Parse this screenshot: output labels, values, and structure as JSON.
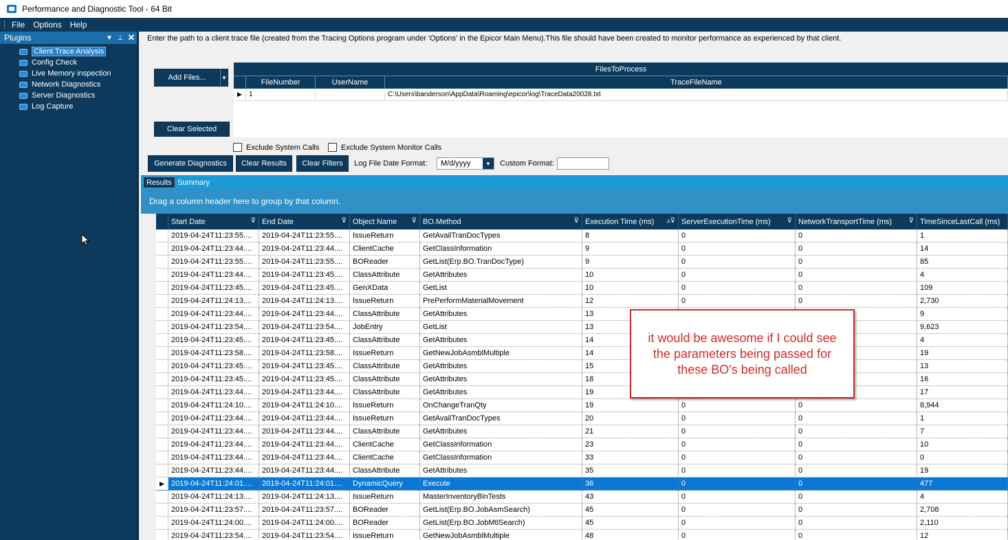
{
  "window": {
    "title": "Performance and Diagnostic Tool - 64 Bit"
  },
  "menu": [
    "File",
    "Options",
    "Help"
  ],
  "left_panel": {
    "title": "Plugins",
    "items": [
      {
        "label": "Client Trace Analysis",
        "selected": true
      },
      {
        "label": "Config Check"
      },
      {
        "label": "Live Memory inspection"
      },
      {
        "label": "Network Diagnostics"
      },
      {
        "label": "Server Diagnostics"
      },
      {
        "label": "Log Capture"
      }
    ]
  },
  "description": "Enter the path to a client trace file (created from the Tracing Options program under 'Options' in the Epicor Main Menu).This file should have been created to monitor performance as experienced by that client.",
  "files": {
    "add_label": "Add Files...",
    "clear_selected_label": "Clear Selected",
    "caption": "FilesToProcess",
    "columns": [
      "FileNumber",
      "UserName",
      "TraceFileName"
    ],
    "rows": [
      {
        "file_number": "1",
        "user_name": "",
        "trace_file": "C:\\Users\\banderson\\AppData\\Roaming\\epicor\\log\\TraceData20028.txt"
      }
    ]
  },
  "options": {
    "exclude_system_calls": "Exclude System Calls",
    "exclude_system_monitor_calls": "Exclude System Monitor Calls"
  },
  "toolbar": {
    "generate": "Generate Diagnostics",
    "clear_results": "Clear Results",
    "clear_filters": "Clear Filters",
    "date_format_label": "Log File Date Format:",
    "date_format_value": "M/d/yyyy",
    "custom_format_label": "Custom Format:",
    "custom_format_value": ""
  },
  "tabs": [
    "Results",
    "Summary"
  ],
  "group_hint": "Drag a column header here to group by that column.",
  "grid": {
    "columns": [
      "Start Date",
      "End Date",
      "Object Name",
      "BO.Method",
      "Execution Time (ms)",
      "ServerExecutionTime (ms)",
      "NetworkTransportTime (ms)",
      "TimeSinceLastCall (ms)"
    ],
    "rows": [
      [
        "2019-04-24T11:23:55....",
        "2019-04-24T11:23:55....",
        "IssueReturn",
        "GetAvailTranDocTypes",
        "8",
        "0",
        "0",
        "1"
      ],
      [
        "2019-04-24T11:23:44....",
        "2019-04-24T11:23:44....",
        "ClientCache",
        "GetClassInformation",
        "9",
        "0",
        "0",
        "14"
      ],
      [
        "2019-04-24T11:23:55....",
        "2019-04-24T11:23:55....",
        "BOReader",
        "GetList(Erp.BO.TranDocType)",
        "9",
        "0",
        "0",
        "85"
      ],
      [
        "2019-04-24T11:23:44....",
        "2019-04-24T11:23:45....",
        "ClassAttribute",
        "GetAttributes",
        "10",
        "0",
        "0",
        "4"
      ],
      [
        "2019-04-24T11:23:45....",
        "2019-04-24T11:23:45....",
        "GenXData",
        "GetList",
        "10",
        "0",
        "0",
        "109"
      ],
      [
        "2019-04-24T11:24:13....",
        "2019-04-24T11:24:13....",
        "IssueReturn",
        "PrePerformMaterialMovement",
        "12",
        "0",
        "0",
        "2,730"
      ],
      [
        "2019-04-24T11:23:44....",
        "2019-04-24T11:23:44....",
        "ClassAttribute",
        "GetAttributes",
        "13",
        "",
        "",
        "9"
      ],
      [
        "2019-04-24T11:23:54....",
        "2019-04-24T11:23:54....",
        "JobEntry",
        "GetList",
        "13",
        "",
        "",
        "9,623"
      ],
      [
        "2019-04-24T11:23:45....",
        "2019-04-24T11:23:45....",
        "ClassAttribute",
        "GetAttributes",
        "14",
        "",
        "",
        "4"
      ],
      [
        "2019-04-24T11:23:58....",
        "2019-04-24T11:23:58....",
        "IssueReturn",
        "GetNewJobAsmblMultiple",
        "14",
        "",
        "",
        "19"
      ],
      [
        "2019-04-24T11:23:45....",
        "2019-04-24T11:23:45....",
        "ClassAttribute",
        "GetAttributes",
        "15",
        "",
        "",
        "13"
      ],
      [
        "2019-04-24T11:23:45....",
        "2019-04-24T11:23:45....",
        "ClassAttribute",
        "GetAttributes",
        "18",
        "",
        "",
        "16"
      ],
      [
        "2019-04-24T11:23:44....",
        "2019-04-24T11:23:44....",
        "ClassAttribute",
        "GetAttributes",
        "19",
        "",
        "",
        "17"
      ],
      [
        "2019-04-24T11:24:10....",
        "2019-04-24T11:24:10....",
        "IssueReturn",
        "OnChangeTranQty",
        "19",
        "0",
        "0",
        "8,944"
      ],
      [
        "2019-04-24T11:23:44....",
        "2019-04-24T11:23:44....",
        "IssueReturn",
        "GetAvailTranDocTypes",
        "20",
        "0",
        "0",
        "1"
      ],
      [
        "2019-04-24T11:23:44....",
        "2019-04-24T11:23:44....",
        "ClassAttribute",
        "GetAttributes",
        "21",
        "0",
        "0",
        "7"
      ],
      [
        "2019-04-24T11:23:44....",
        "2019-04-24T11:23:44....",
        "ClientCache",
        "GetClassInformation",
        "23",
        "0",
        "0",
        "10"
      ],
      [
        "2019-04-24T11:23:44....",
        "2019-04-24T11:23:44....",
        "ClientCache",
        "GetClassInformation",
        "33",
        "0",
        "0",
        "0"
      ],
      [
        "2019-04-24T11:23:44....",
        "2019-04-24T11:23:44....",
        "ClassAttribute",
        "GetAttributes",
        "35",
        "0",
        "0",
        "19"
      ],
      [
        "2019-04-24T11:24:01....",
        "2019-04-24T11:24:01....",
        "DynamicQuery",
        "Execute",
        "36",
        "0",
        "0",
        "477"
      ],
      [
        "2019-04-24T11:24:13....",
        "2019-04-24T11:24:13....",
        "IssueReturn",
        "MasterInventoryBinTests",
        "43",
        "0",
        "0",
        "4"
      ],
      [
        "2019-04-24T11:23:57....",
        "2019-04-24T11:23:57....",
        "BOReader",
        "GetList(Erp.BO.JobAsmSearch)",
        "45",
        "0",
        "0",
        "2,708"
      ],
      [
        "2019-04-24T11:24:00....",
        "2019-04-24T11:24:00....",
        "BOReader",
        "GetList(Erp.BO.JobMtlSearch)",
        "45",
        "0",
        "0",
        "2,110"
      ],
      [
        "2019-04-24T11:23:54....",
        "2019-04-24T11:23:54....",
        "IssueReturn",
        "GetNewJobAsmblMultiple",
        "48",
        "0",
        "0",
        "12"
      ]
    ],
    "active_row": 19
  },
  "callout": {
    "text": "it would be awesome if I could see the parameters being passed for these BO's being called"
  }
}
